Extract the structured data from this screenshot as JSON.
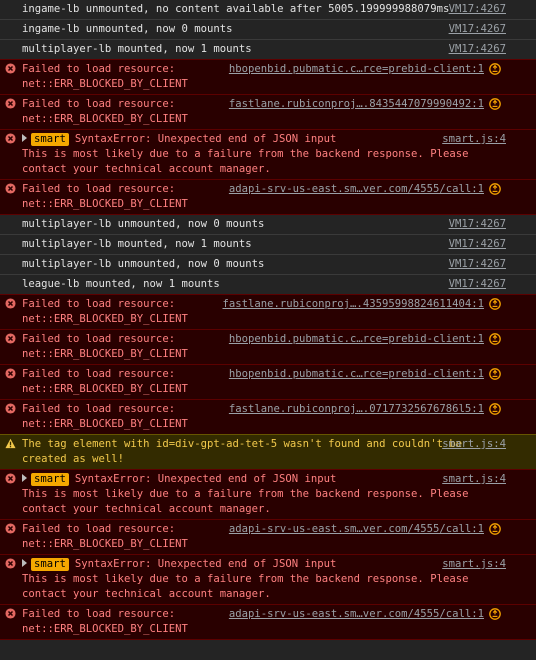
{
  "rows": [
    {
      "type": "log",
      "text": "ingame-lb unmounted, no content available after 5005.199999988079ms",
      "source": "VM17:4267"
    },
    {
      "type": "log",
      "text": "ingame-lb unmounted, now 0 mounts",
      "source": "VM17:4267"
    },
    {
      "type": "log",
      "text": "multiplayer-lb mounted, now 1 mounts",
      "source": "VM17:4267"
    },
    {
      "type": "error",
      "text": "Failed to load resource:\nnet::ERR_BLOCKED_BY_CLIENT",
      "source": "hbopenbid.pubmatic.c…rce=prebid-client:1"
    },
    {
      "type": "error",
      "text": "Failed to load resource:\nnet::ERR_BLOCKED_BY_CLIENT",
      "source": "fastlane.rubiconproj….8435447079990492:1"
    },
    {
      "type": "error-smart",
      "badge": "smart",
      "text": "SyntaxError: Unexpected end of JSON input\nThis is most likely due to a failure from the backend response. Please contact your technical account manager.",
      "source": "smart.js:4"
    },
    {
      "type": "error",
      "text": "Failed to load resource:\nnet::ERR_BLOCKED_BY_CLIENT",
      "source": "adapi-srv-us-east.sm…ver.com/4555/call:1"
    },
    {
      "type": "log",
      "text": "multiplayer-lb unmounted, now 0 mounts",
      "source": "VM17:4267"
    },
    {
      "type": "log",
      "text": "multiplayer-lb mounted, now 1 mounts",
      "source": "VM17:4267"
    },
    {
      "type": "log",
      "text": "multiplayer-lb unmounted, now 0 mounts",
      "source": "VM17:4267"
    },
    {
      "type": "log",
      "text": "league-lb mounted, now 1 mounts",
      "source": "VM17:4267"
    },
    {
      "type": "error",
      "text": "Failed to load resource:\nnet::ERR_BLOCKED_BY_CLIENT",
      "source": "fastlane.rubiconproj….43595998824611404:1"
    },
    {
      "type": "error",
      "text": "Failed to load resource:\nnet::ERR_BLOCKED_BY_CLIENT",
      "source": "hbopenbid.pubmatic.c…rce=prebid-client:1"
    },
    {
      "type": "error",
      "text": "Failed to load resource:\nnet::ERR_BLOCKED_BY_CLIENT",
      "source": "hbopenbid.pubmatic.c…rce=prebid-client:1"
    },
    {
      "type": "error",
      "text": "Failed to load resource:\nnet::ERR_BLOCKED_BY_CLIENT",
      "source": "fastlane.rubiconproj….07177325676786l5:1"
    },
    {
      "type": "warning",
      "text": "The tag element with id=div-gpt-ad-tet-5 wasn't found and couldn't be created as well!",
      "source": "smart.js:4"
    },
    {
      "type": "error-smart",
      "badge": "smart",
      "text": "SyntaxError: Unexpected end of JSON input\nThis is most likely due to a failure from the backend response. Please contact your technical account manager.",
      "source": "smart.js:4"
    },
    {
      "type": "error",
      "text": "Failed to load resource:\nnet::ERR_BLOCKED_BY_CLIENT",
      "source": "adapi-srv-us-east.sm…ver.com/4555/call:1"
    },
    {
      "type": "error-smart",
      "badge": "smart",
      "text": "SyntaxError: Unexpected end of JSON input\nThis is most likely due to a failure from the backend response. Please contact your technical account manager.",
      "source": "smart.js:4"
    },
    {
      "type": "error",
      "text": "Failed to load resource:\nnet::ERR_BLOCKED_BY_CLIENT",
      "source": "adapi-srv-us-east.sm…ver.com/4555/call:1"
    }
  ],
  "icons": {
    "error": "error-circle-x-icon",
    "warning": "warning-triangle-icon",
    "reload": "network-reload-icon",
    "expand": "expand-triangle-icon"
  },
  "colors": {
    "error_text": "#ff8080",
    "error_bg": "#290000",
    "warning_text": "#f2c94c",
    "warning_bg": "#332b00",
    "badge_bg": "#f5a800",
    "log_bg": "#242424"
  }
}
